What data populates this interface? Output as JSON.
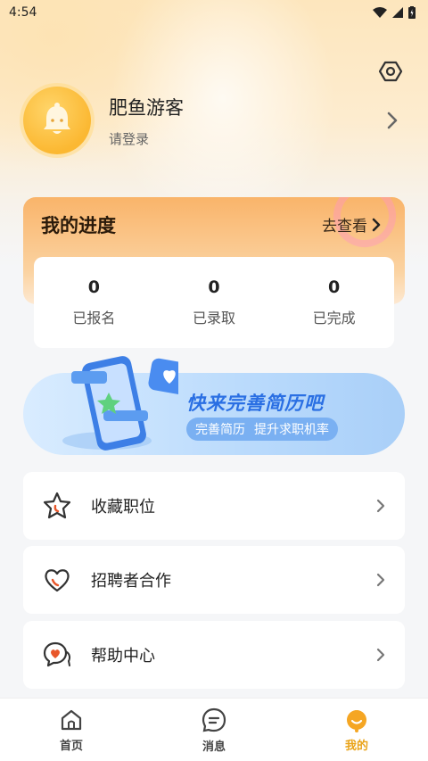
{
  "status_bar": {
    "time": "4:54"
  },
  "profile": {
    "name": "肥鱼游客",
    "subtitle": "请登录"
  },
  "progress": {
    "title": "我的进度",
    "link": "去查看",
    "stats": [
      {
        "value": "0",
        "label": "已报名"
      },
      {
        "value": "0",
        "label": "已录取"
      },
      {
        "value": "0",
        "label": "已完成"
      }
    ]
  },
  "banner": {
    "title": "快来完善简历吧",
    "pill_left": "完善简历",
    "pill_right": "提升求职机率"
  },
  "menu": [
    {
      "label": "收藏职位",
      "icon": "star-icon"
    },
    {
      "label": "招聘者合作",
      "icon": "heart-icon"
    },
    {
      "label": "帮助中心",
      "icon": "chat-heart-icon"
    }
  ],
  "tabs": [
    {
      "label": "首页",
      "icon": "home-icon"
    },
    {
      "label": "消息",
      "icon": "message-icon"
    },
    {
      "label": "我的",
      "icon": "profile-icon",
      "active": true
    }
  ],
  "colors": {
    "accent": "#e9a318",
    "banner_blue": "#2a6fe3",
    "progress_orange": "#f9b46a"
  }
}
